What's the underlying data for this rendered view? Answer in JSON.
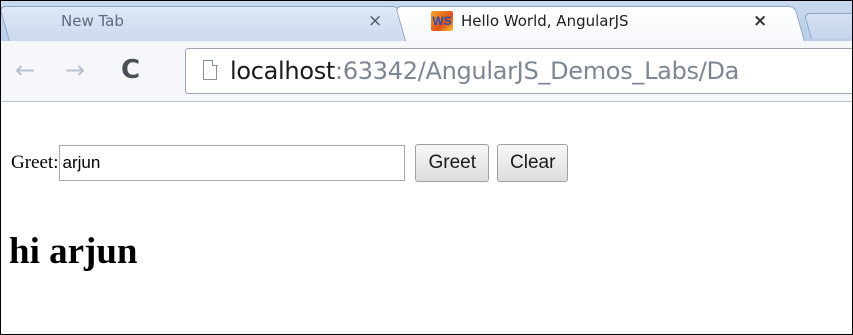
{
  "browser": {
    "tabs": [
      {
        "title": "New Tab",
        "close": "×",
        "active": false
      },
      {
        "title": "Hello World, AngularJS",
        "close": "×",
        "active": true,
        "favicon": "WS"
      }
    ],
    "nav": {
      "back_icon": "←",
      "forward_icon": "→",
      "reload_icon": "C"
    },
    "address": {
      "host": "localhost",
      "rest": ":63342/AngularJS_Demos_Labs/Da"
    }
  },
  "page": {
    "greet_label": "Greet:",
    "input_value": "arjun",
    "greet_button": "Greet",
    "clear_button": "Clear",
    "result": "hi arjun"
  },
  "colors": {
    "tabstrip": "#c9d9ef",
    "url_host": "#1a1a1a",
    "url_rest": "#7d8692"
  }
}
